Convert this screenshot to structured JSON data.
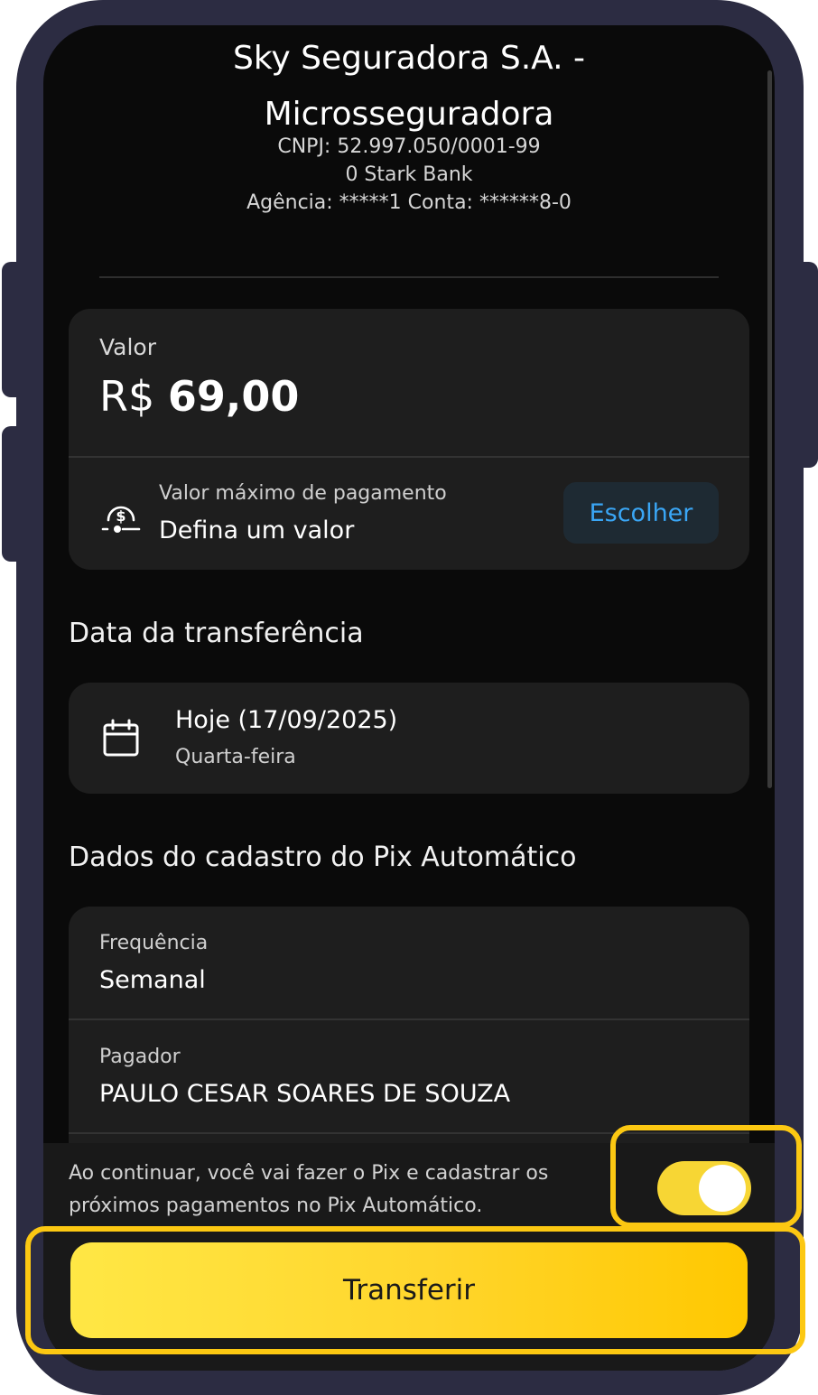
{
  "recipient": {
    "name": "Sky Seguradora S.A. - Microsseguradora",
    "cnpj": "CNPJ: 52.997.050/0001-99",
    "bank": "0 Stark Bank",
    "account": "Agência: *****1 Conta: ******8-0"
  },
  "amount": {
    "label": "Valor",
    "currency": "R$",
    "value": "69,00"
  },
  "max_payment": {
    "label": "Valor máximo de pagamento",
    "value": "Defina um valor",
    "button": "Escolher",
    "icon": "max-payment-icon"
  },
  "transfer_date": {
    "section_title": "Data da transferência",
    "main": "Hoje (17/09/2025)",
    "weekday": "Quarta-feira",
    "icon": "calendar-icon"
  },
  "pix_registration": {
    "section_title": "Dados do cadastro do Pix Automático",
    "frequency_label": "Frequência",
    "frequency_value": "Semanal",
    "payer_label": "Pagador",
    "payer_value": "PAULO CESAR SOARES DE SOUZA"
  },
  "footer": {
    "consent_text": "Ao continuar, você vai fazer o Pix e cadastrar os próximos pagamentos no Pix Automático.",
    "toggle_on": true,
    "transfer_button": "Transferir"
  },
  "colors": {
    "accent_yellow": "#ffd52b",
    "link_blue": "#3aa6f5",
    "highlight": "#fcc812",
    "background": "#0a0a0a",
    "card": "#1e1e1e"
  }
}
